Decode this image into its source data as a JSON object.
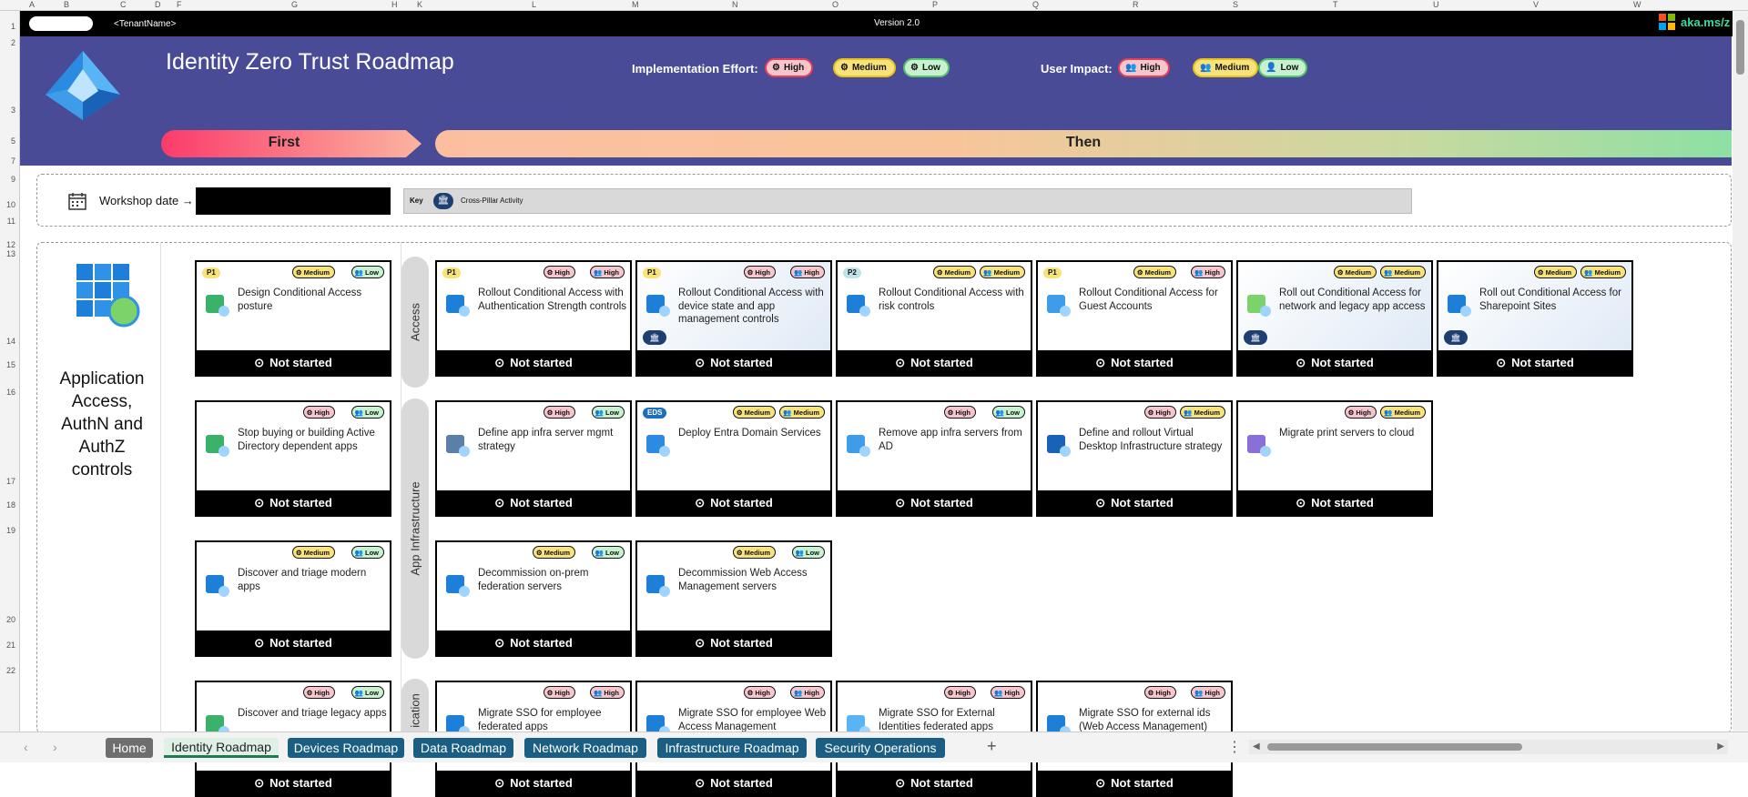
{
  "spreadsheet": {
    "columns": [
      "A",
      "B",
      "C",
      "D",
      "F",
      "G",
      "H",
      "K",
      "L",
      "M",
      "N",
      "O",
      "P",
      "Q",
      "R",
      "S",
      "T",
      "U",
      "V",
      "W"
    ],
    "rows": [
      "1",
      "2",
      "3",
      "5",
      "7",
      "9",
      "10",
      "11",
      "12",
      "13",
      "14",
      "15",
      "16",
      "17",
      "18",
      "19",
      "20",
      "21",
      "22"
    ]
  },
  "topbar": {
    "tenant": "<TenantName>",
    "version": "Version 2.0",
    "link": "aka.ms/z"
  },
  "header": {
    "title": "Identity Zero Trust Roadmap",
    "effort_label": "Implementation Effort:",
    "impact_label": "User Impact:",
    "effort": [
      "High",
      "Medium",
      "Low"
    ],
    "impact": [
      "High",
      "Medium",
      "Low"
    ],
    "first": "First",
    "then": "Then"
  },
  "workshop": {
    "label": "Workshop date →",
    "key_label": "Key",
    "key_item": "Cross-Pillar Activity"
  },
  "section": {
    "title": "Application Access, AuthN and AuthZ controls"
  },
  "pillars": [
    "Access",
    "App Infrastructure",
    "ication"
  ],
  "status": "Not started",
  "cards": [
    {
      "tag": "P1",
      "effort": "Medium",
      "impact": "Low",
      "title": "Design Conditional Access posture"
    },
    {
      "tag": "P1",
      "effort": "High",
      "impact": "High",
      "title": "Rollout Conditional Access with Authentication Strength controls"
    },
    {
      "tag": "P1",
      "effort": "High",
      "impact": "High",
      "title": "Rollout Conditional Access with device state and app management controls"
    },
    {
      "tag": "P2",
      "effort": "Medium",
      "impact": "Medium",
      "title": "Rollout Conditional Access with risk controls"
    },
    {
      "tag": "P1",
      "effort": "Medium",
      "impact": "High",
      "title": "Rollout Conditional Access for Guest Accounts"
    },
    {
      "tag": "",
      "effort": "Medium",
      "impact": "Medium",
      "title": "Roll out Conditional Access for network and legacy app access"
    },
    {
      "tag": "",
      "effort": "Medium",
      "impact": "Medium",
      "title": "Roll out Conditional Access for Sharepoint Sites"
    },
    {
      "tag": "",
      "effort": "High",
      "impact": "Low",
      "title": "Stop buying or building Active Directory dependent apps"
    },
    {
      "tag": "",
      "effort": "High",
      "impact": "Low",
      "title": "Define app infra server mgmt strategy"
    },
    {
      "tag": "EDS",
      "effort": "Medium",
      "impact": "Medium",
      "title": "Deploy Entra Domain Services"
    },
    {
      "tag": "",
      "effort": "High",
      "impact": "Low",
      "title": "Remove app infra servers from AD"
    },
    {
      "tag": "",
      "effort": "High",
      "impact": "Medium",
      "title": "Define and rollout Virtual Desktop Infrastructure strategy"
    },
    {
      "tag": "",
      "effort": "High",
      "impact": "Medium",
      "title": "Migrate print servers to cloud"
    },
    {
      "tag": "",
      "effort": "Medium",
      "impact": "Low",
      "title": "Discover and triage modern apps"
    },
    {
      "tag": "",
      "effort": "Medium",
      "impact": "Low",
      "title": "Decommission on-prem federation servers"
    },
    {
      "tag": "",
      "effort": "Medium",
      "impact": "Low",
      "title": "Decommission Web Access Management servers"
    },
    {
      "tag": "",
      "effort": "High",
      "impact": "Low",
      "title": "Discover and triage legacy apps"
    },
    {
      "tag": "",
      "effort": "High",
      "impact": "High",
      "title": "Migrate SSO for employee federated apps"
    },
    {
      "tag": "",
      "effort": "High",
      "impact": "High",
      "title": "Migrate SSO for employee Web Access Management"
    },
    {
      "tag": "",
      "effort": "High",
      "impact": "High",
      "title": "Migrate SSO for External Identities federated apps"
    },
    {
      "tag": "",
      "effort": "High",
      "impact": "High",
      "title": "Migrate SSO for external ids (Web Access Management)"
    }
  ],
  "tabs": [
    "Home",
    "Identity Roadmap",
    "Devices Roadmap",
    "Data Roadmap",
    "Network Roadmap",
    "Infrastructure Roadmap",
    "Security Operations"
  ],
  "colors": {
    "banner": "#4a4b97",
    "high": "#f7c6cd",
    "medium": "#f8e27a",
    "low": "#c8f1cf",
    "tab": "#1b5e83"
  }
}
